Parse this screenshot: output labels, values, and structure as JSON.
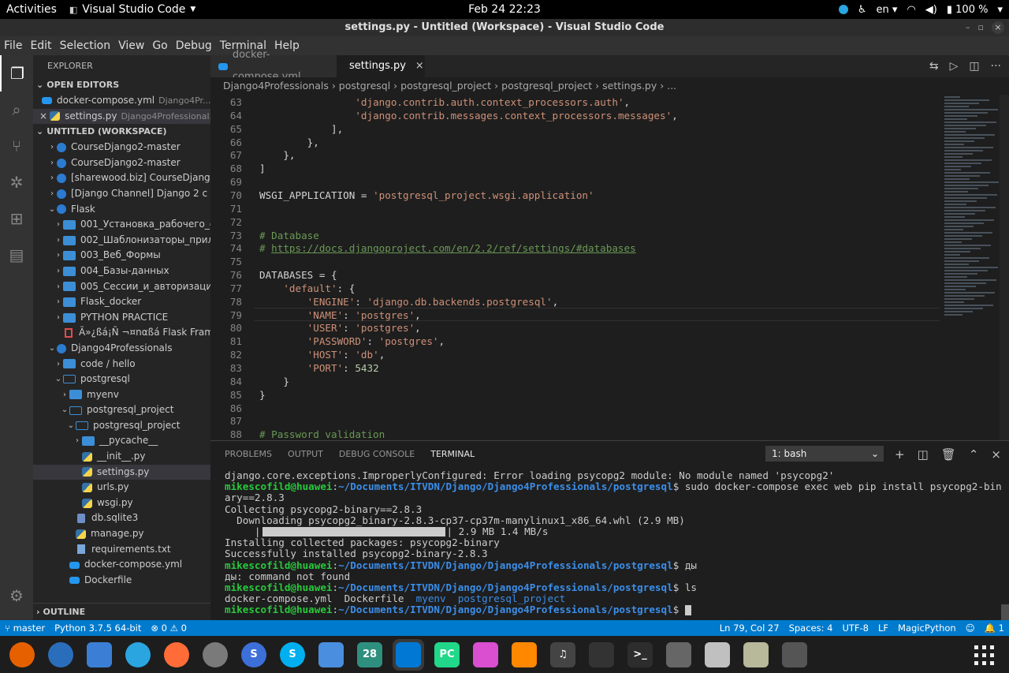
{
  "topbar": {
    "activities": "Activities",
    "app_name": "Visual Studio Code",
    "clock": "Feb 24  22:23",
    "lang": "en",
    "battery": "100 %"
  },
  "window": {
    "title": "settings.py - Untitled (Workspace) - Visual Studio Code"
  },
  "menu": [
    "File",
    "Edit",
    "Selection",
    "View",
    "Go",
    "Debug",
    "Terminal",
    "Help"
  ],
  "explorer": {
    "header": "EXPLORER",
    "open_editors_label": "OPEN EDITORS",
    "open_editors": [
      {
        "name": "docker-compose.yml",
        "desc": "Django4Pr..."
      },
      {
        "name": "settings.py",
        "desc": "Django4Professional..."
      }
    ],
    "workspace_label": "UNTITLED (WORKSPACE)",
    "outline_label": "OUTLINE",
    "tree": [
      {
        "name": "CourseDjango2-master",
        "depth": 0,
        "icon": "root",
        "chev": "›"
      },
      {
        "name": "CourseDjango2-master",
        "depth": 0,
        "icon": "root",
        "chev": "›"
      },
      {
        "name": "[sharewood.biz] CourseDjango...",
        "depth": 0,
        "icon": "root",
        "chev": "›"
      },
      {
        "name": "[Django Channel] Django 2 с ну...",
        "depth": 0,
        "icon": "root",
        "chev": "›"
      },
      {
        "name": "Flask",
        "depth": 0,
        "icon": "root",
        "chev": "⌄"
      },
      {
        "name": "001_Установка_рабочего_о...",
        "depth": 1,
        "icon": "folder",
        "chev": "›"
      },
      {
        "name": "002_Шаблонизаторы_прил...",
        "depth": 1,
        "icon": "folder",
        "chev": "›"
      },
      {
        "name": "003_Веб_Формы",
        "depth": 1,
        "icon": "folder",
        "chev": "›"
      },
      {
        "name": "004_Базы-данных",
        "depth": 1,
        "icon": "folder",
        "chev": "›"
      },
      {
        "name": "005_Сессии_и_авторизация",
        "depth": 1,
        "icon": "folder",
        "chev": "›"
      },
      {
        "name": "Flask_docker",
        "depth": 1,
        "icon": "folder",
        "chev": "›"
      },
      {
        "name": "PYTHON PRACTICE",
        "depth": 1,
        "icon": "folder",
        "chev": "›"
      },
      {
        "name": "Ã»¿ßá¡Ñ ¬¤nαßá Flask Frame...",
        "depth": 1,
        "icon": "pdf",
        "chev": ""
      },
      {
        "name": "Django4Professionals",
        "depth": 0,
        "icon": "root",
        "chev": "⌄"
      },
      {
        "name": "code / hello",
        "depth": 1,
        "icon": "folder",
        "chev": "›"
      },
      {
        "name": "postgresql",
        "depth": 1,
        "icon": "folderopen",
        "chev": "⌄"
      },
      {
        "name": "myenv",
        "depth": 2,
        "icon": "folder",
        "chev": "›"
      },
      {
        "name": "postgresql_project",
        "depth": 2,
        "icon": "folderopen",
        "chev": "⌄"
      },
      {
        "name": "postgresql_project",
        "depth": 3,
        "icon": "folderopen",
        "chev": "⌄"
      },
      {
        "name": "__pycache__",
        "depth": 4,
        "icon": "folder",
        "chev": "›"
      },
      {
        "name": "__init__.py",
        "depth": 4,
        "icon": "py",
        "chev": ""
      },
      {
        "name": "settings.py",
        "depth": 4,
        "icon": "py",
        "chev": "",
        "selected": true
      },
      {
        "name": "urls.py",
        "depth": 4,
        "icon": "py",
        "chev": ""
      },
      {
        "name": "wsgi.py",
        "depth": 4,
        "icon": "py",
        "chev": ""
      },
      {
        "name": "db.sqlite3",
        "depth": 3,
        "icon": "db",
        "chev": ""
      },
      {
        "name": "manage.py",
        "depth": 3,
        "icon": "py",
        "chev": ""
      },
      {
        "name": "requirements.txt",
        "depth": 3,
        "icon": "file",
        "chev": ""
      },
      {
        "name": "docker-compose.yml",
        "depth": 2,
        "icon": "dock",
        "chev": ""
      },
      {
        "name": "Dockerfile",
        "depth": 2,
        "icon": "dock",
        "chev": ""
      }
    ]
  },
  "tabs": [
    {
      "label": "docker-compose.yml",
      "active": false
    },
    {
      "label": "settings.py",
      "active": true
    }
  ],
  "breadcrumb": "Django4Professionals › postgresql › postgresql_project › postgresql_project › settings.py › ...",
  "editor": {
    "lines": [
      {
        "n": "63",
        "html": "                <span class=\"s\">'django.contrib.auth.context_processors.auth'</span>,"
      },
      {
        "n": "64",
        "html": "                <span class=\"s\">'django.contrib.messages.context_processors.messages'</span>,"
      },
      {
        "n": "65",
        "html": "            ],"
      },
      {
        "n": "66",
        "html": "        },"
      },
      {
        "n": "67",
        "html": "    },"
      },
      {
        "n": "68",
        "html": "]"
      },
      {
        "n": "69",
        "html": ""
      },
      {
        "n": "70",
        "html": "WSGI_APPLICATION = <span class=\"s\">'postgresql_project.wsgi.application'</span>"
      },
      {
        "n": "71",
        "html": ""
      },
      {
        "n": "72",
        "html": ""
      },
      {
        "n": "73",
        "html": "<span class=\"c\"># Database</span>"
      },
      {
        "n": "74",
        "html": "<span class=\"c\"># </span><span class=\"cl\">https://docs.djangoproject.com/en/2.2/ref/settings/#databases</span>"
      },
      {
        "n": "75",
        "html": ""
      },
      {
        "n": "76",
        "html": "DATABASES = {"
      },
      {
        "n": "77",
        "html": "    <span class=\"s\">'default'</span>: {"
      },
      {
        "n": "78",
        "html": "        <span class=\"s\">'ENGINE'</span>: <span class=\"s\">'django.db.backends.postgresql'</span>,"
      },
      {
        "n": "79",
        "html": "        <span class=\"s\">'NAME'</span>: <span class=\"s\">'postgres'</span>,"
      },
      {
        "n": "80",
        "html": "        <span class=\"s\">'USER'</span>: <span class=\"s\">'postgres'</span>,"
      },
      {
        "n": "81",
        "html": "        <span class=\"s\">'PASSWORD'</span>: <span class=\"s\">'postgres'</span>,"
      },
      {
        "n": "82",
        "html": "        <span class=\"s\">'HOST'</span>: <span class=\"s\">'db'</span>,"
      },
      {
        "n": "83",
        "html": "        <span class=\"s\">'PORT'</span>: <span class=\"n\">5432</span>"
      },
      {
        "n": "84",
        "html": "    }"
      },
      {
        "n": "85",
        "html": "}"
      },
      {
        "n": "86",
        "html": ""
      },
      {
        "n": "87",
        "html": ""
      },
      {
        "n": "88",
        "html": "<span class=\"c\"># Password validation</span>"
      }
    ]
  },
  "panel": {
    "tabs": [
      "PROBLEMS",
      "OUTPUT",
      "DEBUG CONSOLE",
      "TERMINAL"
    ],
    "terminal_select": "1: bash",
    "lines": [
      {
        "text": "django.core.exceptions.ImproperlyConfigured: Error loading psycopg2 module: No module named 'psycopg2'"
      },
      {
        "user": "mikescofild@huawei",
        "path": "~/Documents/ITVDN/Django/Django4Professionals/postgresql",
        "cmd": "$ sudo docker-compose exec web pip install psycopg2-bin"
      },
      {
        "text": "ary==2.8.3"
      },
      {
        "text": "Collecting psycopg2-binary==2.8.3"
      },
      {
        "text": "  Downloading psycopg2_binary-2.8.3-cp37-cp37m-manylinux1_x86_64.whl (2.9 MB)"
      },
      {
        "progress": "2.9 MB 1.4 MB/s"
      },
      {
        "text": "Installing collected packages: psycopg2-binary"
      },
      {
        "text": "Successfully installed psycopg2-binary-2.8.3"
      },
      {
        "user": "mikescofild@huawei",
        "path": "~/Documents/ITVDN/Django/Django4Professionals/postgresql",
        "cmd": "$ ды"
      },
      {
        "text": "ды: command not found"
      },
      {
        "user": "mikescofild@huawei",
        "path": "~/Documents/ITVDN/Django/Django4Professionals/postgresql",
        "cmd": "$ ls"
      },
      {
        "ls": [
          "docker-compose.yml",
          "Dockerfile",
          "myenv",
          "postgresql_project"
        ]
      },
      {
        "user": "mikescofild@huawei",
        "path": "~/Documents/ITVDN/Django/Django4Professionals/postgresql",
        "cmd": "$ ",
        "cursor": true
      }
    ]
  },
  "statusbar": {
    "branch": "master",
    "python": "Python 3.7.5 64-bit",
    "problems": "⊗ 0 ⚠ 0",
    "position": "Ln 79, Col 27",
    "spaces": "Spaces: 4",
    "encoding": "UTF-8",
    "eol": "LF",
    "language": "MagicPython",
    "notifications": "1"
  },
  "dock": [
    {
      "name": "firefox-icon",
      "color": "#e66000",
      "label": "",
      "round": true
    },
    {
      "name": "thunderbird-icon",
      "color": "#2a6ebb",
      "label": "",
      "round": true
    },
    {
      "name": "libreoffice-icon",
      "color": "#3a7fd5",
      "label": ""
    },
    {
      "name": "telegram-icon",
      "color": "#2aa5e0",
      "label": "",
      "round": true
    },
    {
      "name": "postman-icon",
      "color": "#ff6c37",
      "label": "",
      "round": true
    },
    {
      "name": "settings-icon",
      "color": "#7a7a7a",
      "label": "",
      "round": true
    },
    {
      "name": "simplenote-icon",
      "color": "#3d6fd9",
      "label": "S",
      "round": true
    },
    {
      "name": "skype-icon",
      "color": "#00aff0",
      "label": "S",
      "round": true
    },
    {
      "name": "tasks-icon",
      "color": "#4a8ee0",
      "label": ""
    },
    {
      "name": "calendar-icon",
      "color": "#2f8f7f",
      "label": "28"
    },
    {
      "name": "vscode-icon",
      "color": "#0078d4",
      "label": "",
      "active": true
    },
    {
      "name": "pycharm-icon",
      "color": "#21d789",
      "label": "PC"
    },
    {
      "name": "gem-icon",
      "color": "#d94fd0",
      "label": ""
    },
    {
      "name": "vlc-icon",
      "color": "#ff8800",
      "label": ""
    },
    {
      "name": "music-icon",
      "color": "#444",
      "label": "♫"
    },
    {
      "name": "system-monitor-icon",
      "color": "#333",
      "label": ""
    },
    {
      "name": "terminal-icon",
      "color": "#2d2d2d",
      "label": ">_"
    },
    {
      "name": "search-icon",
      "color": "#666",
      "label": ""
    },
    {
      "name": "help-icon",
      "color": "#c0c0c0",
      "label": ""
    },
    {
      "name": "notes-icon",
      "color": "#b8b89a",
      "label": ""
    },
    {
      "name": "usb-icon",
      "color": "#555",
      "label": ""
    }
  ]
}
